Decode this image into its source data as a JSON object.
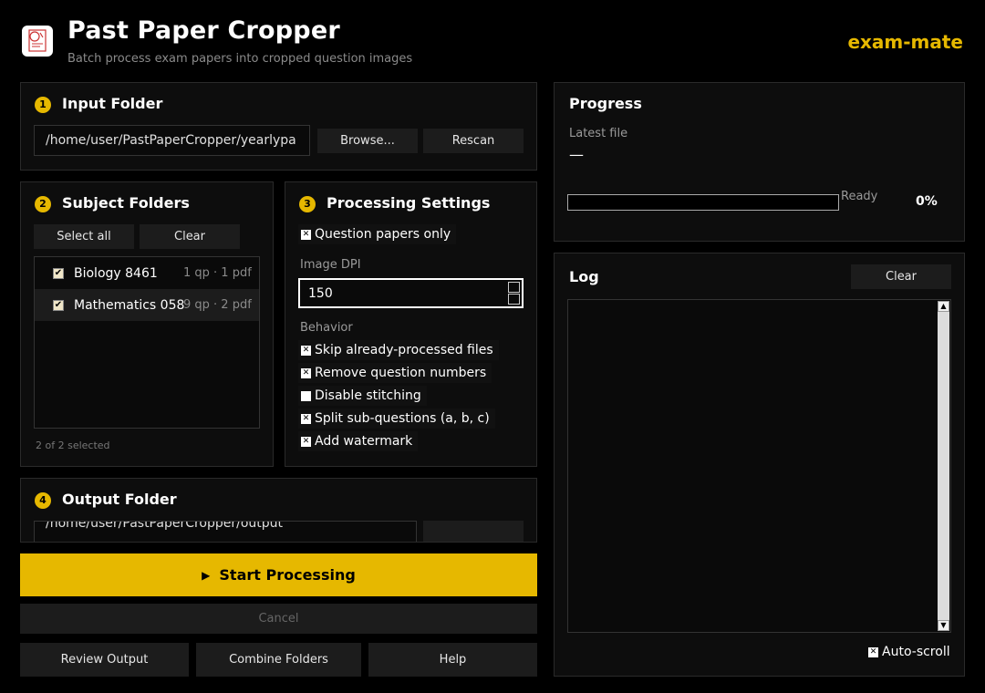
{
  "header": {
    "title": "Past Paper Cropper",
    "subtitle": "Batch process exam papers into cropped question images",
    "brand": "exam-mate"
  },
  "input_folder": {
    "step": "1",
    "title": "Input Folder",
    "path": "/home/user/PastPaperCropper/yearlypa",
    "browse_label": "Browse...",
    "rescan_label": "Rescan"
  },
  "subject_folders": {
    "step": "2",
    "title": "Subject Folders",
    "select_all_label": "Select all",
    "clear_label": "Clear",
    "items": [
      {
        "name": "Biology 8461",
        "meta": "1 qp · 1 pdf",
        "checked": true
      },
      {
        "name": "Mathematics 0580",
        "meta": "9 qp · 2 pdf",
        "checked": true
      }
    ],
    "selected_summary": "2 of 2 selected"
  },
  "processing_settings": {
    "step": "3",
    "title": "Processing Settings",
    "question_papers_only": "Question papers only",
    "dpi_label": "Image DPI",
    "dpi_value": "150",
    "behavior_label": "Behavior",
    "options": [
      {
        "label": "Skip already-processed files",
        "checked": true
      },
      {
        "label": "Remove question numbers",
        "checked": true
      },
      {
        "label": "Disable stitching",
        "checked": false
      },
      {
        "label": "Split sub-questions (a, b, c)",
        "checked": true
      },
      {
        "label": "Add watermark",
        "checked": true
      }
    ]
  },
  "output_folder": {
    "step": "4",
    "title": "Output Folder",
    "path": "/home/user/PastPaperCropper/output"
  },
  "actions": {
    "start_label": "Start Processing",
    "cancel_label": "Cancel",
    "review_label": "Review Output",
    "combine_label": "Combine Folders",
    "help_label": "Help"
  },
  "progress": {
    "title": "Progress",
    "latest_file_label": "Latest file",
    "latest_file_value": "—",
    "status": "Ready",
    "percent_label": "0%",
    "fraction": 0
  },
  "log": {
    "title": "Log",
    "clear_label": "Clear",
    "autoscroll_label": "Auto-scroll"
  },
  "colors": {
    "accent": "#e6b800",
    "background": "#000000",
    "panel": "#0d0d0d"
  }
}
